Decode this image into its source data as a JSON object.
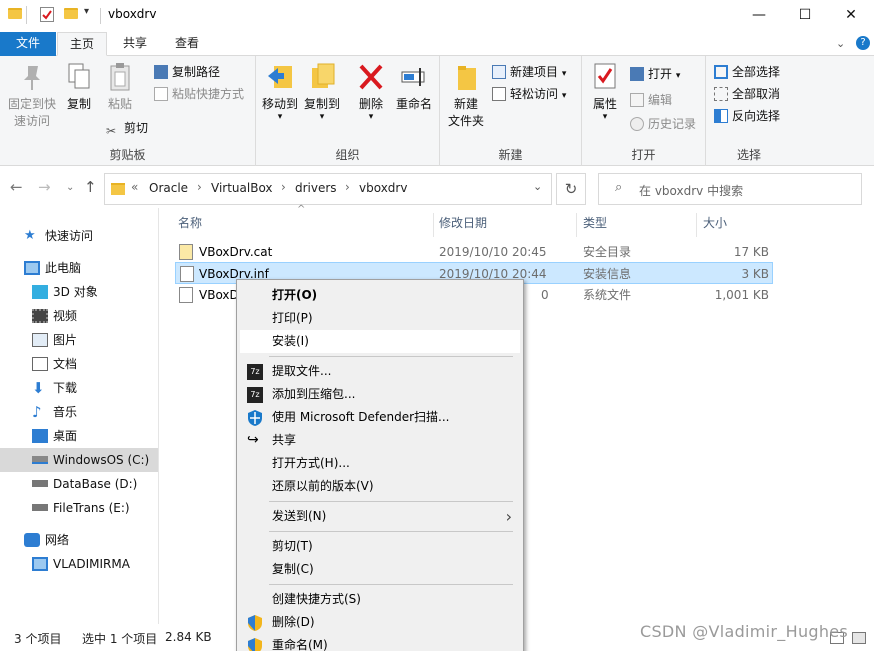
{
  "window": {
    "title": "vboxdrv",
    "controls": {
      "minimize": "—",
      "maximize": "☐",
      "close": "✕"
    }
  },
  "ribbon_tabs": [
    {
      "label": "文件"
    },
    {
      "label": "主页"
    },
    {
      "label": "共享"
    },
    {
      "label": "查看"
    }
  ],
  "ribbon": {
    "clipboard": {
      "pin_label_1": "固定到快",
      "pin_label_2": "速访问",
      "copy": "复制",
      "paste": "粘贴",
      "copy_path": "复制路径",
      "paste_shortcut": "粘贴快捷方式",
      "cut": "剪切",
      "group_label": "剪贴板"
    },
    "organize": {
      "move_to": "移动到",
      "copy_to": "复制到",
      "delete": "删除",
      "rename": "重命名",
      "group_label": "组织"
    },
    "new": {
      "new_folder_1": "新建",
      "new_folder_2": "文件夹",
      "new_item": "新建项目",
      "easy_access": "轻松访问",
      "group_label": "新建"
    },
    "open": {
      "properties": "属性",
      "open": "打开",
      "edit": "编辑",
      "history": "历史记录",
      "group_label": "打开"
    },
    "select": {
      "select_all": "全部选择",
      "select_none": "全部取消",
      "invert": "反向选择",
      "group_label": "选择"
    }
  },
  "address": {
    "overflow": "«",
    "crumbs": [
      "Oracle",
      "VirtualBox",
      "drivers",
      "vboxdrv"
    ],
    "separator": "›",
    "search_placeholder": "在 vboxdrv 中搜索"
  },
  "navpane": {
    "items": [
      {
        "label": "快速访问",
        "icon": "star-icon"
      },
      {
        "label": "此电脑",
        "icon": "computer-icon"
      },
      {
        "label": "3D 对象",
        "icon": "cube-icon"
      },
      {
        "label": "视频",
        "icon": "video-icon"
      },
      {
        "label": "图片",
        "icon": "picture-icon"
      },
      {
        "label": "文档",
        "icon": "document-icon"
      },
      {
        "label": "下载",
        "icon": "download-icon"
      },
      {
        "label": "音乐",
        "icon": "music-icon"
      },
      {
        "label": "桌面",
        "icon": "desktop-icon"
      },
      {
        "label": "WindowsOS (C:)",
        "icon": "drive-icon"
      },
      {
        "label": "DataBase (D:)",
        "icon": "drive-icon"
      },
      {
        "label": "FileTrans (E:)",
        "icon": "drive-icon"
      },
      {
        "label": "网络",
        "icon": "network-icon"
      },
      {
        "label": "VLADIMIRMA",
        "icon": "computer-icon"
      }
    ]
  },
  "filelist": {
    "columns": {
      "name": "名称",
      "date": "修改日期",
      "type": "类型",
      "size": "大小"
    },
    "rows": [
      {
        "name": "VBoxDrv.cat",
        "date": "2019/10/10 20:45",
        "type": "安全目录",
        "size": "17 KB"
      },
      {
        "name": "VBoxDrv.inf",
        "date": "2019/10/10 20:44",
        "type": "安装信息",
        "size": "3 KB"
      },
      {
        "name": "VBoxD",
        "date": "0",
        "type": "系统文件",
        "size": "1,001 KB"
      }
    ]
  },
  "statusbar": {
    "count": "3 个项目",
    "selected": "选中 1 个项目",
    "selected_size": "2.84 KB",
    "watermark": "CSDN @Vladimir_Hughes"
  },
  "context_menu": {
    "items": [
      {
        "label": "打开(O)"
      },
      {
        "label": "打印(P)"
      },
      {
        "label": "安装(I)"
      },
      {
        "label": "提取文件..."
      },
      {
        "label": "添加到压缩包..."
      },
      {
        "label": "使用 Microsoft Defender扫描..."
      },
      {
        "label": "共享"
      },
      {
        "label": "打开方式(H)..."
      },
      {
        "label": "还原以前的版本(V)"
      },
      {
        "label": "发送到(N)"
      },
      {
        "label": "剪切(T)"
      },
      {
        "label": "复制(C)"
      },
      {
        "label": "创建快捷方式(S)"
      },
      {
        "label": "删除(D)"
      },
      {
        "label": "重命名(M)"
      }
    ]
  },
  "colors": {
    "accent": "#1979ca",
    "selection": "#cce8ff",
    "selection_border": "#99d1ff",
    "folder": "#f4c644",
    "delete_red": "#d9191f"
  }
}
